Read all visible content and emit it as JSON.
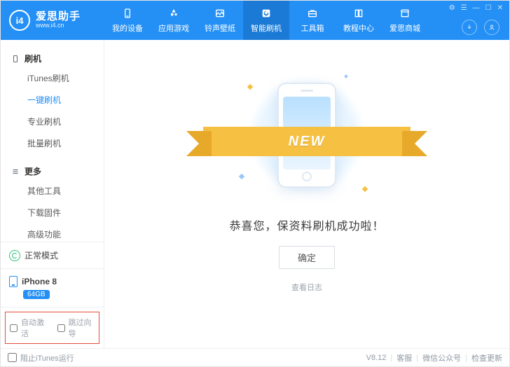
{
  "brand": {
    "name": "爱思助手",
    "url": "www.i4.cn",
    "logo_text": "i4"
  },
  "header": {
    "tabs": [
      {
        "label": "我的设备"
      },
      {
        "label": "应用游戏"
      },
      {
        "label": "铃声壁纸"
      },
      {
        "label": "智能刷机",
        "active": true
      },
      {
        "label": "工具箱"
      },
      {
        "label": "教程中心"
      },
      {
        "label": "爱思商城"
      }
    ]
  },
  "sidebar": {
    "group_flash": {
      "title": "刷机",
      "items": [
        {
          "label": "iTunes刷机"
        },
        {
          "label": "一键刷机",
          "active": true
        },
        {
          "label": "专业刷机"
        },
        {
          "label": "批量刷机"
        }
      ]
    },
    "group_more": {
      "title": "更多",
      "items": [
        {
          "label": "其他工具"
        },
        {
          "label": "下载固件"
        },
        {
          "label": "高级功能"
        }
      ]
    },
    "mode": "正常模式",
    "device": {
      "name": "iPhone 8",
      "storage": "64GB"
    },
    "options": {
      "auto_activate": "自动激活",
      "skip_guide": "跳过向导"
    }
  },
  "main": {
    "ribbon": "NEW",
    "congrats": "恭喜您，保资料刷机成功啦！",
    "ok": "确定",
    "view_log": "查看日志"
  },
  "status": {
    "block_itunes": "阻止iTunes运行",
    "version": "V8.12",
    "support": "客服",
    "wechat": "微信公众号",
    "update": "检查更新"
  }
}
